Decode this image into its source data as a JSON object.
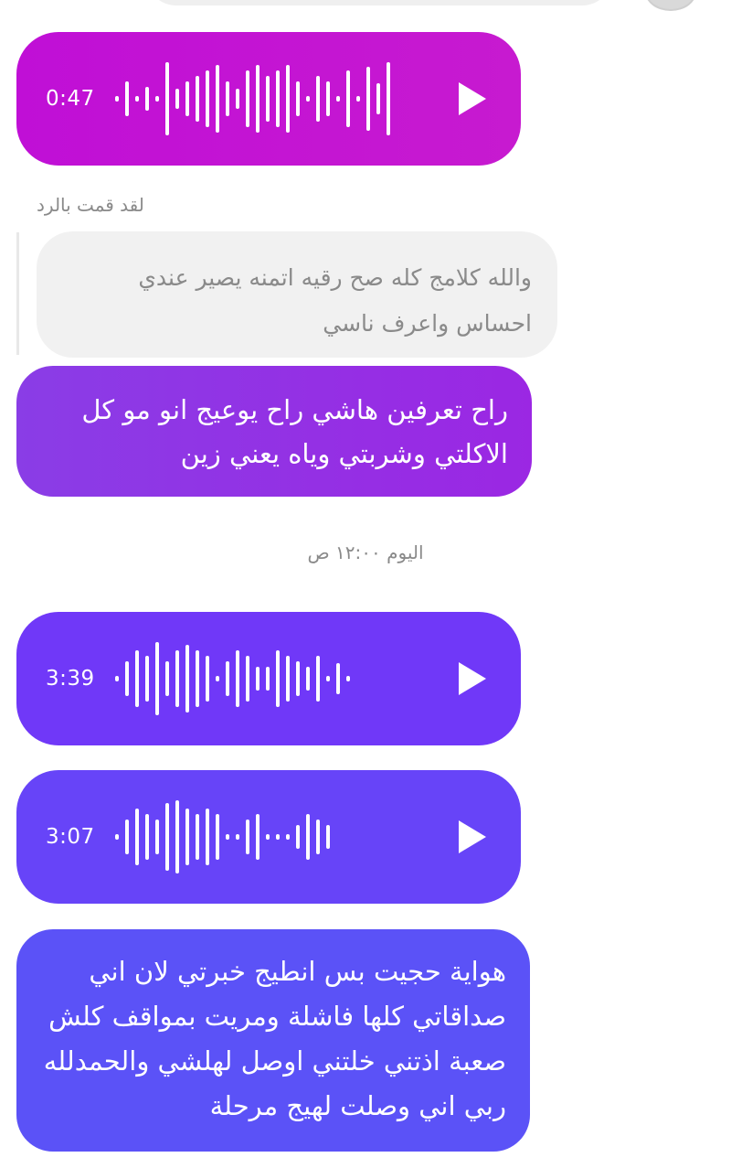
{
  "messages": {
    "voice1": {
      "duration": "0:47",
      "color": "#c40fd4",
      "icon": "play-icon"
    },
    "reply_label": "لقد قمت بالرد",
    "quoted_text": "والله كلامج كله صح رقيه اتمنه يصير عندي احساس واعرف ناسي",
    "text1": "راح تعرفين هاشي راح يوعيج انو مو كل الاكلتي وشربتي وياه يعني زين",
    "date_separator": "اليوم ١٢:٠٠ ص",
    "voice2": {
      "duration": "3:39",
      "color": "#7038f8",
      "icon": "play-icon"
    },
    "voice3": {
      "duration": "3:07",
      "color": "#6744f8",
      "icon": "play-icon"
    },
    "text2": "هواية حجيت بس انطيج خبرتي لان اني صداقاتي كلها فاشلة ومريت بمواقف كلش صعبة اذتني خلتني اوصل لهلشي والحمدلله ربي اني وصلت لهيج مرحلة"
  },
  "colors": {
    "bubble_magenta": "#c40fd4",
    "bubble_purple": "#8f36e5",
    "bubble_violet": "#7038f8",
    "bubble_blue": "#5b52f7",
    "quoted_bg": "#f1f1f1",
    "meta_text": "#8a8a8a"
  }
}
